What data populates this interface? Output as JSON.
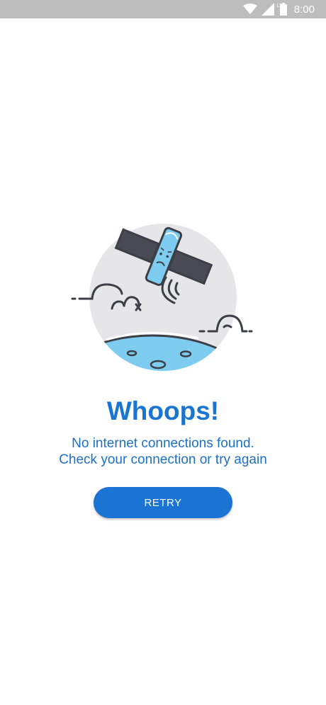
{
  "status_bar": {
    "time": "8:00",
    "network_label": "LTE",
    "icons": [
      "wifi-icon",
      "cellular-signal-icon",
      "battery-icon"
    ]
  },
  "error": {
    "title": "Whoops!",
    "line1": "No internet connections found.",
    "line2": "Check your connection or try again"
  },
  "actions": {
    "retry_label": "RETRY"
  },
  "colors": {
    "accent": "#1b73d3",
    "status_bar": "#bdbdbd",
    "illustration_circle": "#e6e6e8",
    "planet": "#7ecdf1",
    "outline": "#3d3f47"
  }
}
